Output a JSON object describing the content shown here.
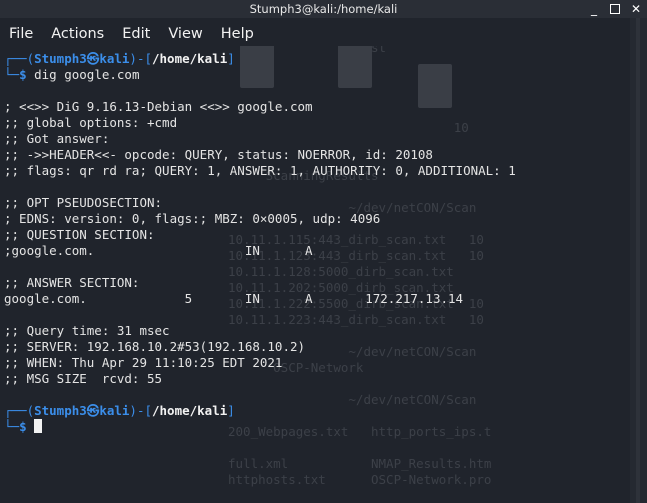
{
  "window": {
    "title": "Stumph3@kali:/home/kali"
  },
  "controls": {
    "minimize": "_",
    "close": "✕"
  },
  "menu": [
    "File",
    "Actions",
    "Edit",
    "View",
    "Help"
  ],
  "background_ghost": [
    "kali_compilation   hindrespon1.bladat",
    "                   st",
    "",
    "",
    "",
    "",
    "                              10",
    "",
    "",
    "     ScanningResults",
    "",
    "                ~/dev/netCON/Scan",
    "",
    "10.11.1.115:443_dirb_scan.txt   10",
    "10.11.1.123:443_dirb_scan.txt   10",
    "10.11.1.128:5000_dirb_scan.txt",
    "10.11.1.202:5000_dirb_scan.txt",
    "10.11.1.222:5500_dirb_scan.txt  10",
    "10.11.1.223:443_dirb_scan.txt   10",
    "",
    "                ~/dev/netCON/Scan",
    "      OSCP-Network",
    "",
    "                ~/dev/netCON/Scan",
    "",
    "200_Webpages.txt   http_ports_ips.t",
    "",
    "full.xml           NMAP_Results.htm",
    "httphosts.txt      OSCP-Network.pro"
  ],
  "terminal": {
    "prompt1": {
      "open": "┌──(",
      "user": "Stumph3",
      "at": "㉿",
      "host": "kali",
      "mid": ")-[",
      "path": "/home/kali",
      "close": "]",
      "lead": "└─",
      "symbol": "$",
      "command": " dig google.com"
    },
    "output": [
      "; <<>> DiG 9.16.13-Debian <<>> google.com",
      ";; global options: +cmd",
      ";; Got answer:",
      ";; ->>HEADER<<- opcode: QUERY, status: NOERROR, id: 20108",
      ";; flags: qr rd ra; QUERY: 1, ANSWER: 1, AUTHORITY: 0, ADDITIONAL: 1",
      "",
      ";; OPT PSEUDOSECTION:",
      "; EDNS: version: 0, flags:; MBZ: 0×0005, udp: 4096",
      ";; QUESTION SECTION:",
      ";google.com.                    IN      A",
      "",
      ";; ANSWER SECTION:",
      "google.com.             5       IN      A       172.217.13.14",
      "",
      ";; Query time: 31 msec",
      ";; SERVER: 192.168.10.2#53(192.168.10.2)",
      ";; WHEN: Thu Apr 29 11:10:25 EDT 2021",
      ";; MSG SIZE  rcvd: 55"
    ],
    "prompt2": {
      "open": "┌──(",
      "user": "Stumph3",
      "at": "㉿",
      "host": "kali",
      "mid": ")-[",
      "path": "/home/kali",
      "close": "]",
      "lead": "└─",
      "symbol": "$"
    }
  },
  "colors": {
    "prompt_blue": "#3b8eea",
    "text": "#e4e4e4",
    "background": "#20242c"
  }
}
